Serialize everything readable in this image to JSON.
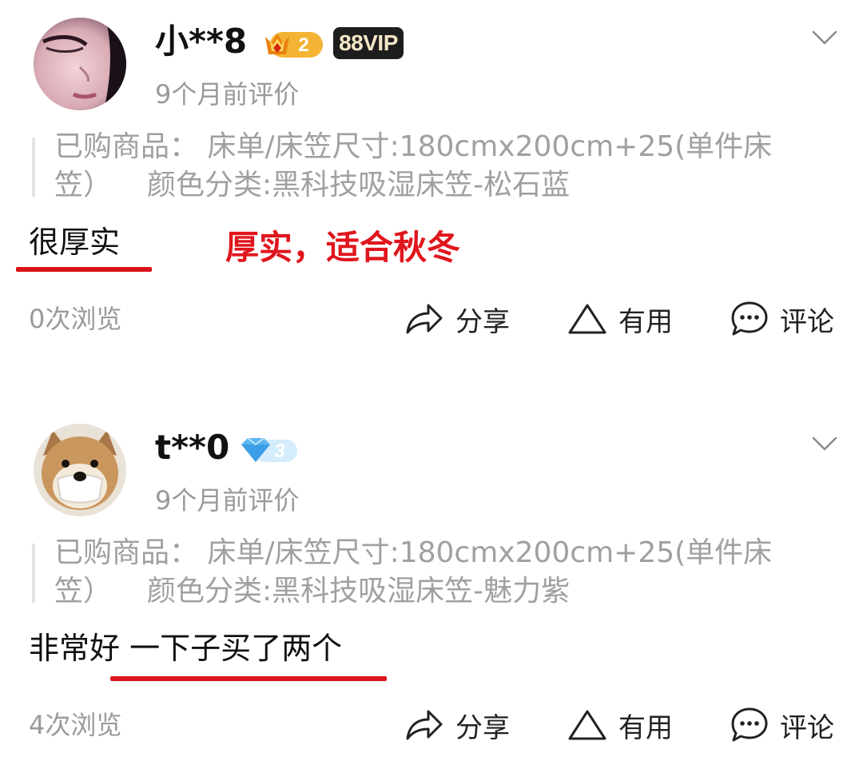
{
  "reviews": [
    {
      "username": "小**8",
      "level_badge": "2",
      "vip_badge": "88VIP",
      "time": "9个月前评价",
      "spec_line1": "已购商品： 床单/床笠尺寸:180cmx200cm+25(单件床",
      "spec_line2_a": "笠）",
      "spec_line2_b": "颜色分类:黑科技吸湿床笠-松石蓝",
      "content": "很厚实",
      "annotation": "厚实，适合秋冬",
      "views": "0次浏览",
      "actions": {
        "share": "分享",
        "useful": "有用",
        "comment": "评论"
      }
    },
    {
      "username": "t**0",
      "level_badge": "3",
      "time": "9个月前评价",
      "spec_line1": "已购商品： 床单/床笠尺寸:180cmx200cm+25(单件床",
      "spec_line2_a": "笠）",
      "spec_line2_b": "颜色分类:黑科技吸湿床笠-魅力紫",
      "content": "非常好 一下子买了两个",
      "views": "4次浏览",
      "actions": {
        "share": "分享",
        "useful": "有用",
        "comment": "评论"
      }
    }
  ],
  "icons": {
    "chevron": "chevron-down-icon",
    "share": "share-arrow-icon",
    "useful": "triangle-useful-icon",
    "comment": "speech-bubble-icon",
    "level1": "crown-level-icon",
    "level2": "diamond-level-icon"
  },
  "colors": {
    "annotation_red": "#e0161d",
    "muted_gray": "#9a9a9a",
    "spec_gray": "#a0a0a0"
  }
}
